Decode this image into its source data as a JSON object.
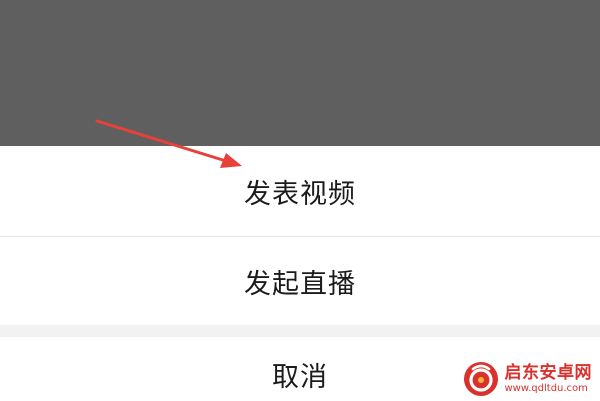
{
  "action_sheet": {
    "items": [
      {
        "label": "发表视频"
      },
      {
        "label": "发起直播"
      }
    ],
    "cancel_label": "取消"
  },
  "watermark": {
    "title": "启东安卓网",
    "url": "www.qdltdu.com",
    "accent_color": "#d8322e"
  },
  "annotation": {
    "arrow_color": "#e8403a",
    "points_to": "发表视频"
  },
  "colors": {
    "overlay": "#5f5f5f",
    "sheet": "#ffffff",
    "gap": "#f2f2f2",
    "divider": "#e6e6e6",
    "text": "#1b1b1b"
  }
}
